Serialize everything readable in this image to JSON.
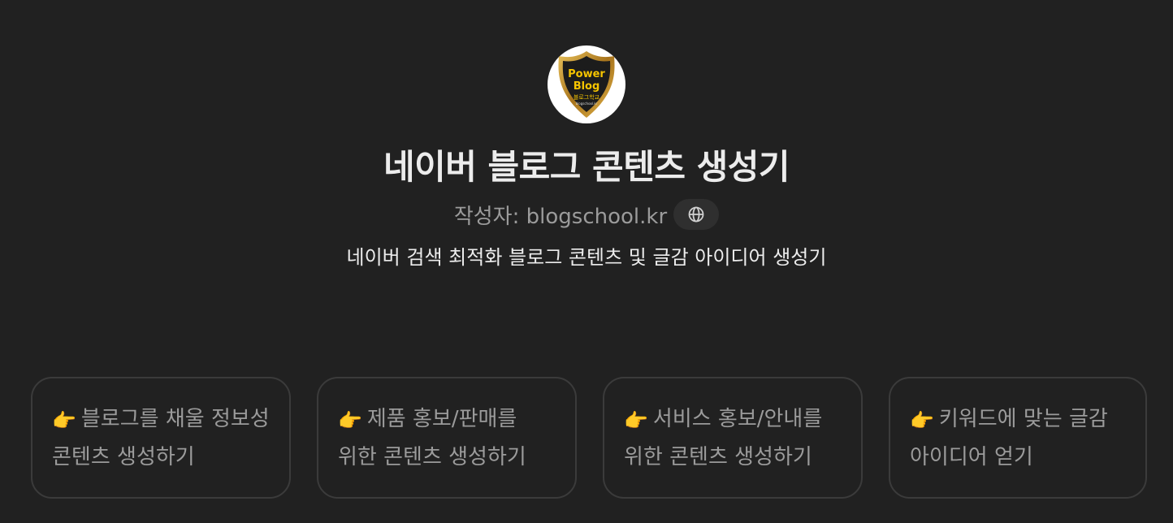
{
  "header": {
    "logo": {
      "text_line1": "Power",
      "text_line2": "Blog",
      "text_line3": "블로그학교",
      "text_line4": "blogschool.kr",
      "icon": "shield-badge-icon"
    },
    "title": "네이버 블로그 콘텐츠 생성기",
    "author": "작성자: blogschool.kr",
    "globe_icon": "globe-icon",
    "description": "네이버 검색 최적화 블로그 콘텐츠 및 글감 아이디어 생성기"
  },
  "cards": [
    {
      "emoji": "👉",
      "text": "블로그를 채울 정보성 콘텐츠 생성하기"
    },
    {
      "emoji": "👉",
      "text": "제품 홍보/판매를 위한 콘텐츠 생성하기"
    },
    {
      "emoji": "👉",
      "text": "서비스 홍보/안내를 위한 콘텐츠 생성하기"
    },
    {
      "emoji": "👉",
      "text": "키워드에 맞는 글감 아이디어 얻기"
    }
  ],
  "colors": {
    "background": "#212121",
    "card_border": "#3b3b3b",
    "muted_text": "#9b9b9b",
    "shield_gold": "#c8962a",
    "shield_dark": "#1c1c1c",
    "shield_text": "#f5c400"
  }
}
